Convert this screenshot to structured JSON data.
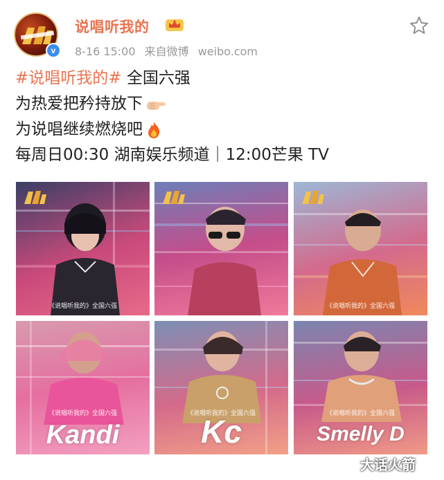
{
  "post": {
    "username": "说唱听我的",
    "time": "8-16 15:00",
    "source": "来自微博",
    "source_domain": "weibo.com"
  },
  "content": {
    "topic": "#说唱听我的#",
    "topic_suffix": " 全国六强",
    "line2": "为热爱把矜持放下",
    "line3": "为说唱继续燃烧吧",
    "line4": "每周日00:30 湖南娱乐频道｜12:00芒果 TV"
  },
  "tiles": [
    {
      "caption": "《说唱听我的》全国六强",
      "name": ""
    },
    {
      "caption": "",
      "name": ""
    },
    {
      "caption": "《说唱听我的》全国六强",
      "name": ""
    },
    {
      "caption": "《说唱听我的》全国六强",
      "name": "Kandi"
    },
    {
      "caption": "《说唱听我的》全国六强",
      "name": "Kc"
    },
    {
      "caption": "《说唱听我的》全国六强",
      "name": "Smelly D"
    }
  ],
  "watermark": "大话火箭",
  "colors": {
    "accent": "#eb7350",
    "meta_gray": "#999999",
    "verified_blue": "#3b8ef0",
    "text": "#222222"
  },
  "icons": {
    "avatar": "show-logo-avatar",
    "verified": "verified-badge-icon",
    "crown": "crown-icon",
    "favorite": "star-icon",
    "hand": "pointing-hand-emoji",
    "fire": "fire-emoji"
  }
}
